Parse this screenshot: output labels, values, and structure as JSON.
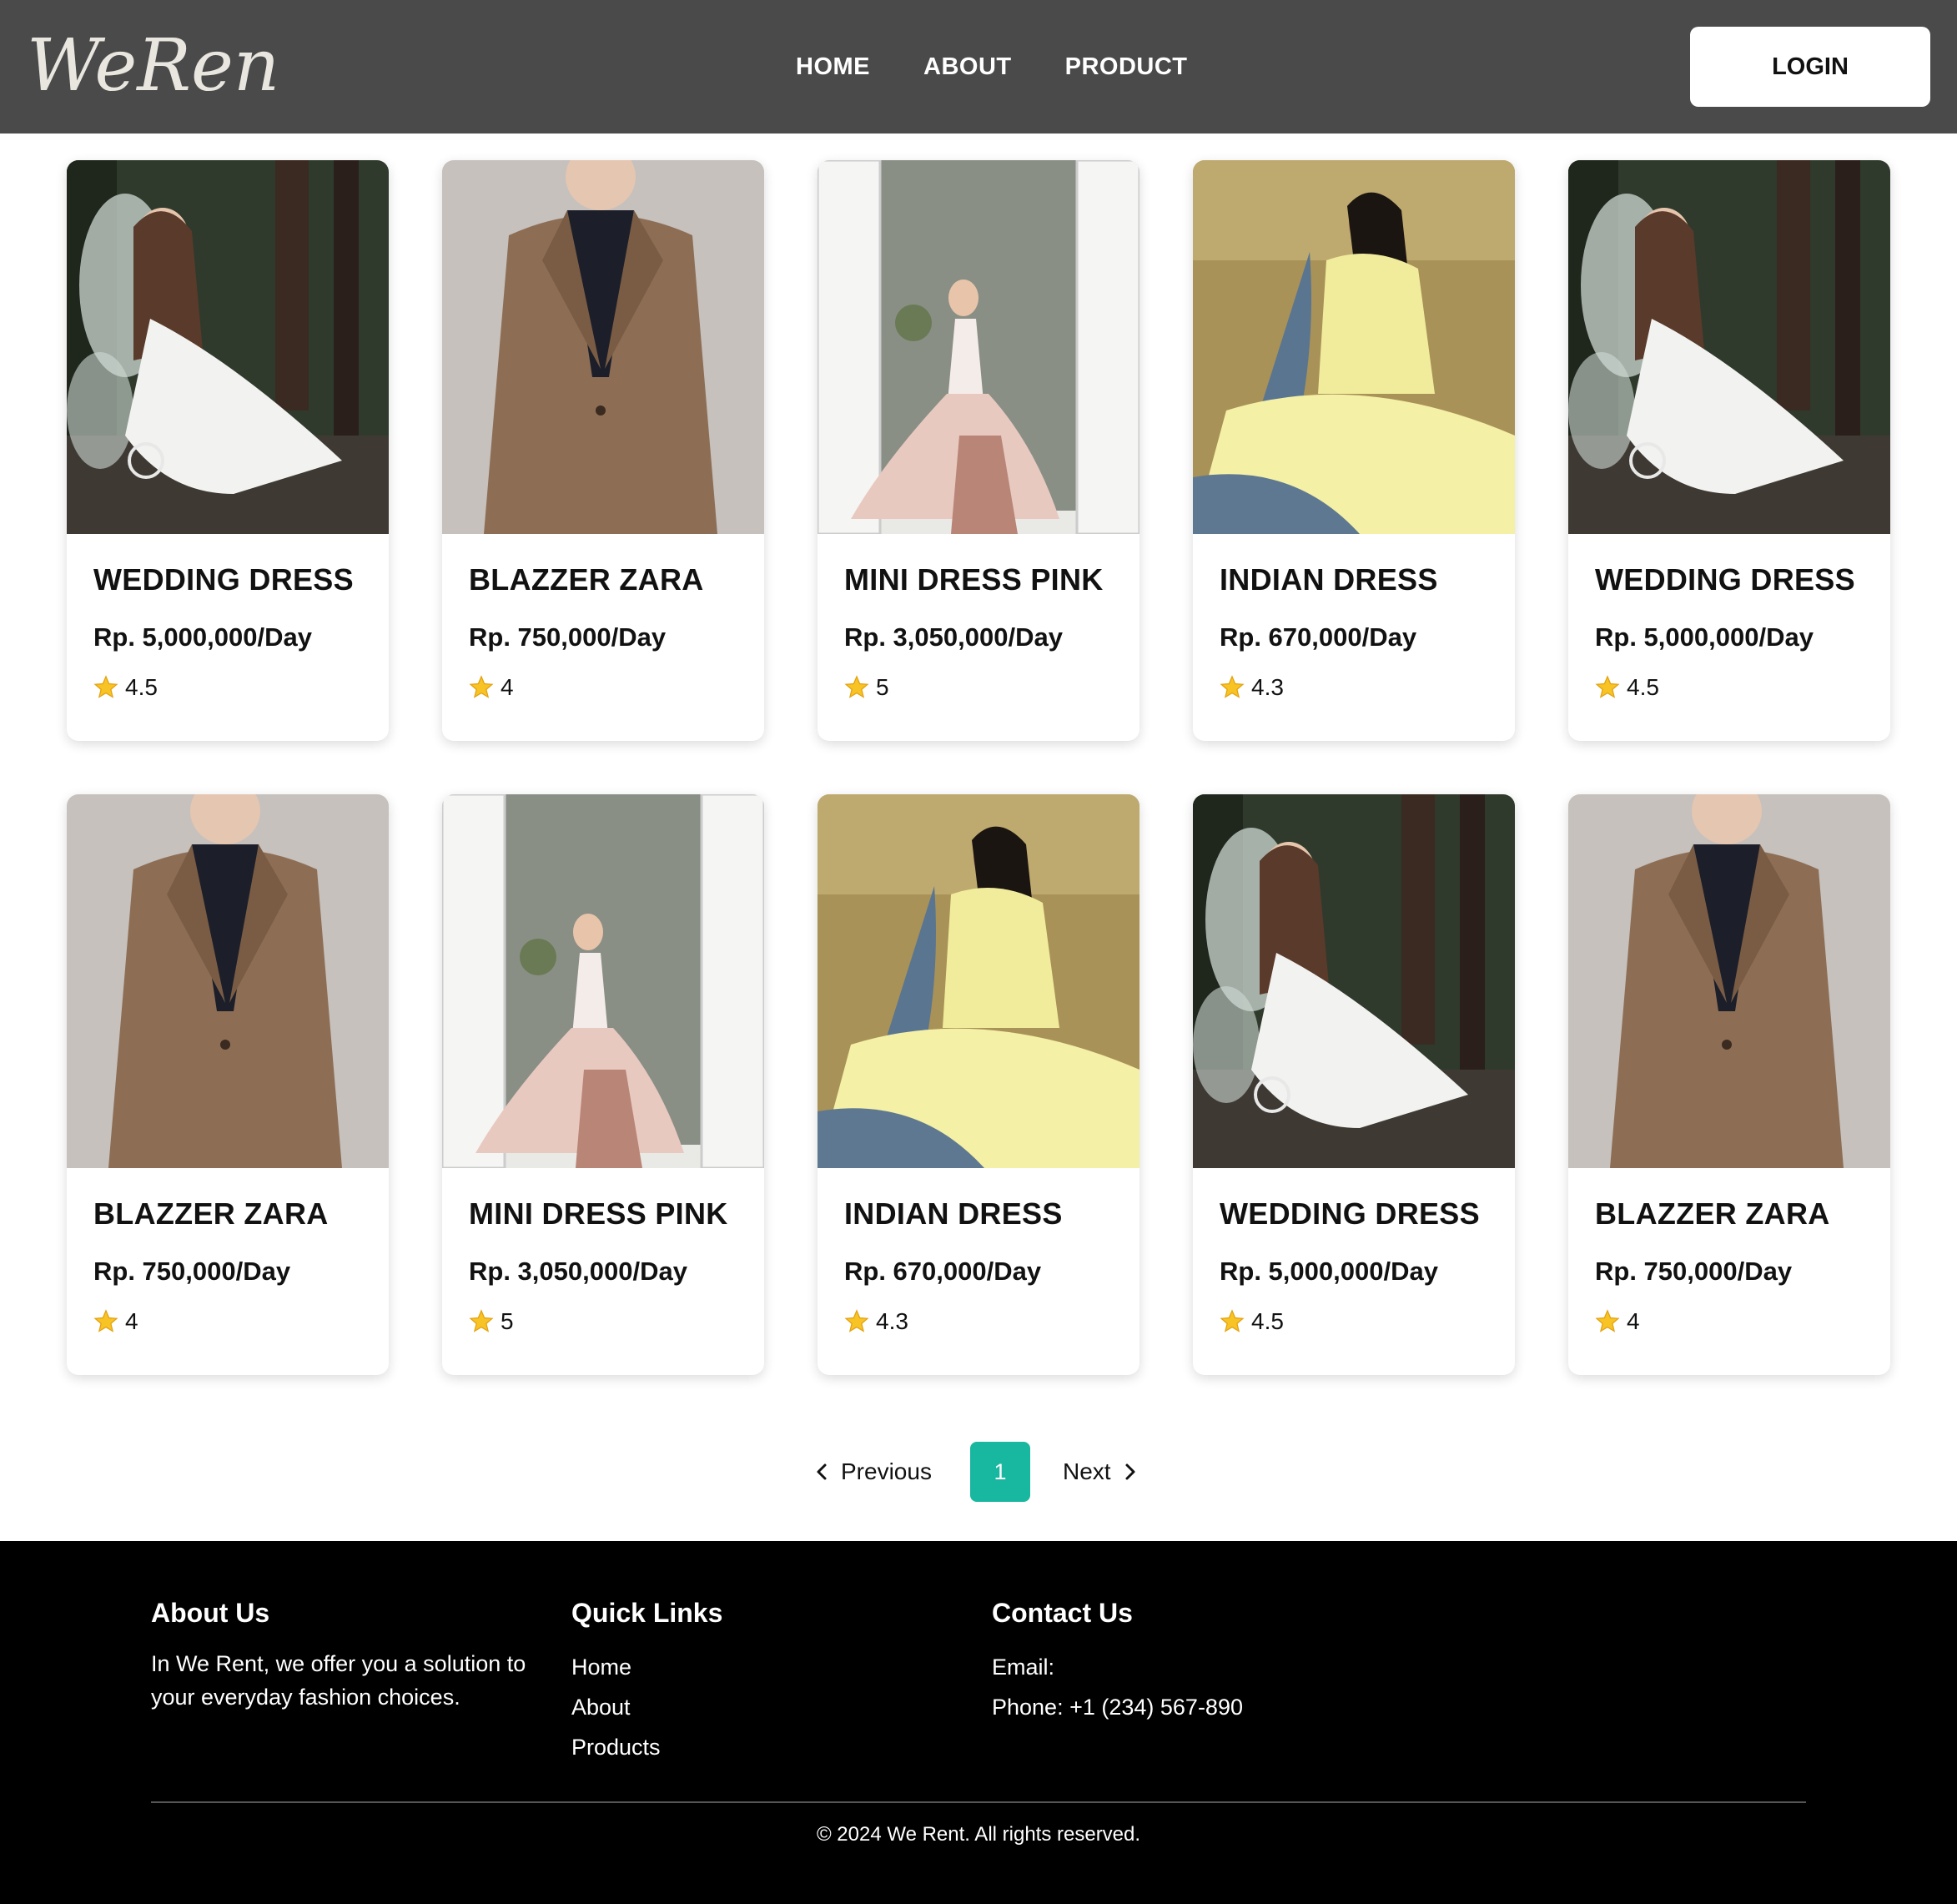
{
  "header": {
    "logo": "WeRent",
    "nav": [
      "HOME",
      "ABOUT",
      "PRODUCT"
    ],
    "login_label": "LOGIN"
  },
  "products": [
    {
      "title": "WEDDING DRESS",
      "price": "Rp. 5,000,000/Day",
      "rating": "4.5",
      "image": "fairy-white-dress-photo"
    },
    {
      "title": "BLAZZER ZARA",
      "price": "Rp. 750,000/Day",
      "rating": "4",
      "image": "plaid-blazer-photo"
    },
    {
      "title": "MINI DRESS PINK",
      "price": "Rp. 3,050,000/Day",
      "rating": "5",
      "image": "pink-gown-doorway-photo"
    },
    {
      "title": "INDIAN DRESS",
      "price": "Rp. 670,000/Day",
      "rating": "4.3",
      "image": "yellow-indian-dress-photo"
    },
    {
      "title": "WEDDING DRESS",
      "price": "Rp. 5,000,000/Day",
      "rating": "4.5",
      "image": "fairy-white-dress-photo"
    },
    {
      "title": "BLAZZER ZARA",
      "price": "Rp. 750,000/Day",
      "rating": "4",
      "image": "plaid-blazer-photo"
    },
    {
      "title": "MINI DRESS PINK",
      "price": "Rp. 3,050,000/Day",
      "rating": "5",
      "image": "pink-gown-doorway-photo"
    },
    {
      "title": "INDIAN DRESS",
      "price": "Rp. 670,000/Day",
      "rating": "4.3",
      "image": "yellow-indian-dress-photo"
    },
    {
      "title": "WEDDING DRESS",
      "price": "Rp. 5,000,000/Day",
      "rating": "4.5",
      "image": "fairy-white-dress-photo"
    },
    {
      "title": "BLAZZER ZARA",
      "price": "Rp. 750,000/Day",
      "rating": "4",
      "image": "plaid-blazer-photo"
    }
  ],
  "pagination": {
    "previous_label": "Previous",
    "current_page": "1",
    "next_label": "Next"
  },
  "footer": {
    "about": {
      "heading": "About Us",
      "text": "In We Rent, we offer you a solution to your everyday fashion choices."
    },
    "quick_links": {
      "heading": "Quick Links",
      "links": [
        "Home",
        "About",
        "Products"
      ]
    },
    "contact": {
      "heading": "Contact Us",
      "email": "Email:",
      "phone": "Phone: +1 (234) 567-890"
    },
    "copyright": "© 2024 We Rent. All rights reserved."
  },
  "colors": {
    "header_bg": "#4a4a4a",
    "accent": "#18b7a0",
    "footer_bg": "#000000"
  }
}
